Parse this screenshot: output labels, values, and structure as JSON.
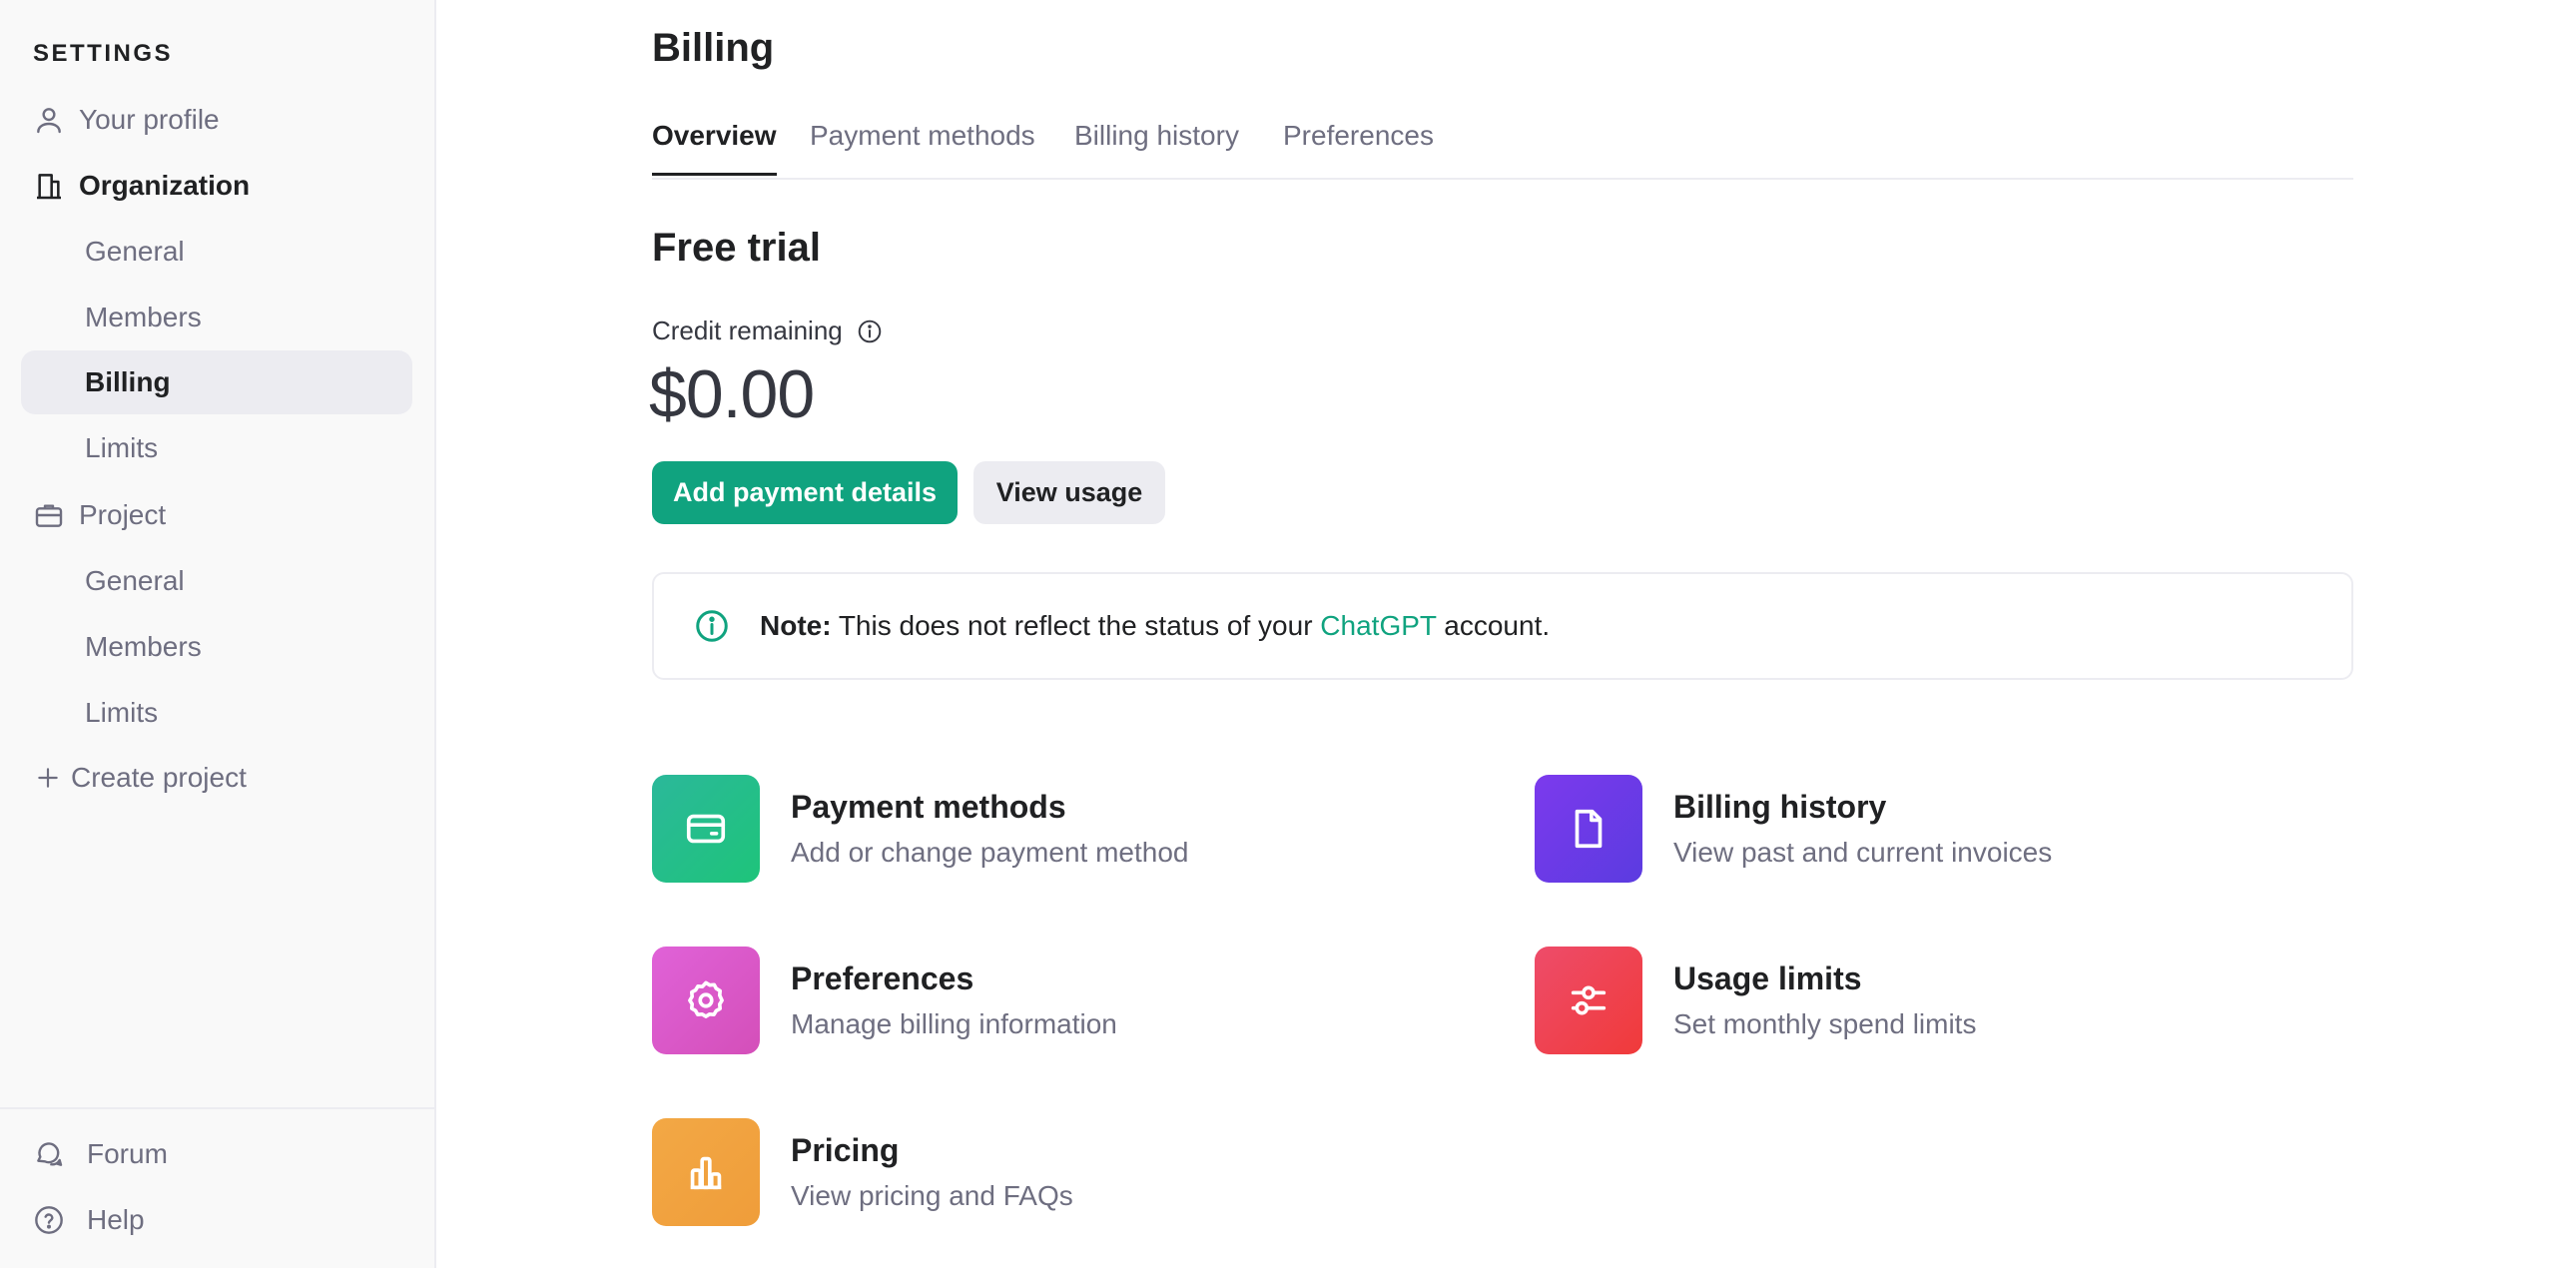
{
  "sidebar": {
    "header": "SETTINGS",
    "items": [
      {
        "label": "Your profile",
        "icon": "user-icon"
      },
      {
        "label": "Organization",
        "icon": "building-icon"
      },
      {
        "label": "General"
      },
      {
        "label": "Members"
      },
      {
        "label": "Billing",
        "active": true
      },
      {
        "label": "Limits"
      },
      {
        "label": "Project",
        "icon": "briefcase-icon"
      },
      {
        "label": "General"
      },
      {
        "label": "Members"
      },
      {
        "label": "Limits"
      },
      {
        "label": "Create project",
        "icon": "plus-icon"
      }
    ],
    "footer": [
      {
        "label": "Forum",
        "icon": "chat-bubbles-icon"
      },
      {
        "label": "Help",
        "icon": "help-circle-icon"
      }
    ]
  },
  "main": {
    "title": "Billing",
    "tabs": [
      {
        "label": "Overview",
        "active": true
      },
      {
        "label": "Payment methods"
      },
      {
        "label": "Billing history"
      },
      {
        "label": "Preferences"
      }
    ],
    "section_title": "Free trial",
    "credit_label": "Credit remaining",
    "credit_value": "$0.00",
    "buttons": {
      "primary": "Add payment details",
      "secondary": "View usage"
    },
    "note": {
      "label": "Note:",
      "text_before": "This does not reflect the status of your ",
      "link": "ChatGPT",
      "text_after": " account."
    },
    "cards": [
      {
        "title": "Payment methods",
        "description": "Add or change payment method",
        "icon": "credit-card-icon"
      },
      {
        "title": "Billing history",
        "description": "View past and current invoices",
        "icon": "document-icon"
      },
      {
        "title": "Preferences",
        "description": "Manage billing information",
        "icon": "gear-icon"
      },
      {
        "title": "Usage limits",
        "description": "Set monthly spend limits",
        "icon": "sliders-icon"
      },
      {
        "title": "Pricing",
        "description": "View pricing and FAQs",
        "icon": "bar-chart-icon"
      }
    ]
  },
  "colors": {
    "accent": "#10a37f",
    "payment_tile": "#1ec47a",
    "history_tile": "#6d3ae8",
    "preferences_tile": "#da58c9",
    "limits_tile": "#ef4152",
    "pricing_tile": "#f1a33f"
  }
}
